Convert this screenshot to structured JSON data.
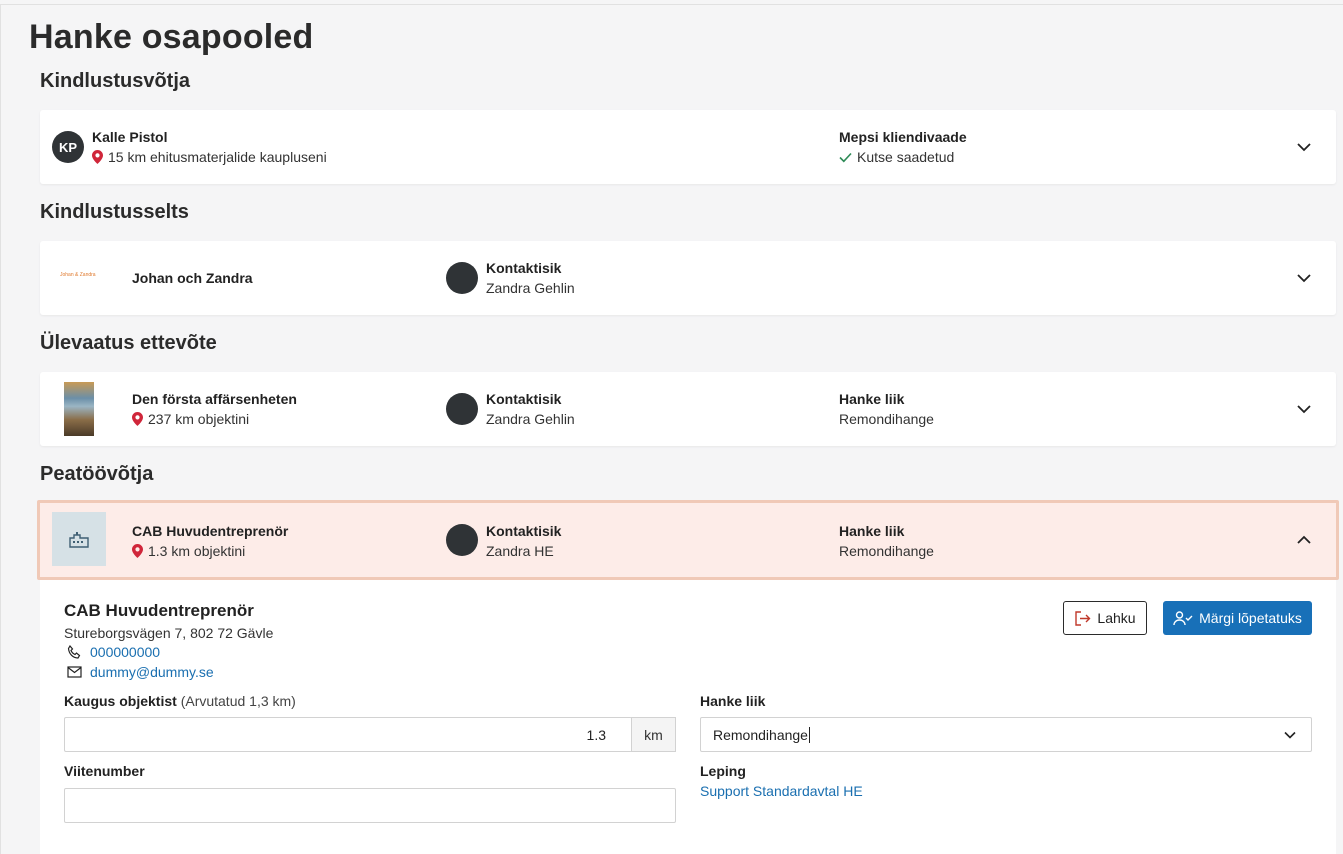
{
  "page": {
    "title": "Hanke osapooled"
  },
  "sections": {
    "insured": {
      "title": "Kindlustusvõtja",
      "initials": "KP",
      "name": "Kalle Pistol",
      "distance": "15 km ehitusmaterjalide kaupluseni",
      "status_label": "Mepsi kliendivaade",
      "status_value": "Kutse saadetud"
    },
    "insurer": {
      "title": "Kindlustusselts",
      "logo_text": "Johan & Zandra",
      "name": "Johan och Zandra",
      "contact_label": "Kontaktisik",
      "contact_name": "Zandra Gehlin"
    },
    "inspection": {
      "title": "Ülevaatus ettevõte",
      "name": "Den första affärsenheten",
      "distance": "237 km objektini",
      "contact_label": "Kontaktisik",
      "contact_name": "Zandra Gehlin",
      "type_label": "Hanke liik",
      "type_value": "Remondihange"
    },
    "main_contractor": {
      "title": "Peatöövõtja",
      "name": "CAB Huvudentreprenör",
      "distance": "1.3 km objektini",
      "contact_label": "Kontaktisik",
      "contact_name": "Zandra HE",
      "type_label": "Hanke liik",
      "type_value": "Remondihange"
    }
  },
  "details": {
    "company": "CAB Huvudentreprenör",
    "address": "Stureborgsvägen 7, 802 72 Gävle",
    "phone": "000000000",
    "email": "dummy@dummy.se",
    "leave_button": "Lahku",
    "complete_button": "Märgi lõpetatuks",
    "distance_label": "Kaugus objektist",
    "distance_hint": "(Arvutatud 1,3 km)",
    "distance_value": "1.3",
    "distance_unit": "km",
    "reference_label": "Viitenumber",
    "reference_value": "",
    "procurement_label": "Hanke liik",
    "procurement_value": "Remondihange",
    "contract_label": "Leping",
    "contract_link": "Support Standardavtal HE"
  },
  "colors": {
    "primary": "#1870b8",
    "link": "#1a6fb0",
    "active_bg": "#fdece8",
    "active_border": "#f0c9b7",
    "pin": "#d0263a",
    "check": "#2e8b57"
  }
}
